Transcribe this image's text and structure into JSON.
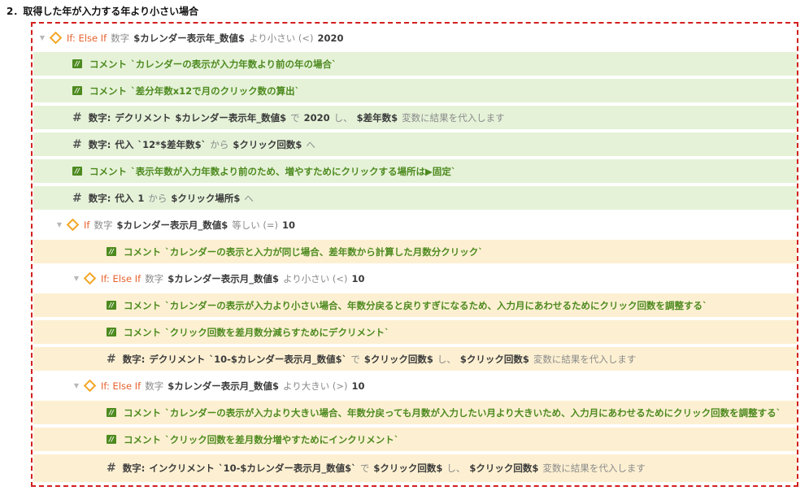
{
  "heading": "2．取得した年が入力する年より小さい場合",
  "rows": [
    {
      "if_kw": "If: Else If",
      "type": "数字",
      "var": "$カレンダー表示年_数値$",
      "cond": "より小さい (<)",
      "val": "2020"
    },
    {
      "label": "コメント",
      "text": "`カレンダーの表示が入力年数より前の年の場合`"
    },
    {
      "label": "コメント",
      "text": "`差分年数x12で月のクリック数の算出`"
    },
    {
      "label": "数字:",
      "action": "デクリメント",
      "var": "$カレンダー表示年_数値$",
      "mid": "で",
      "val": "2020",
      "mid2": "し、",
      "var2": "$差年数$",
      "tail": "変数に結果を代入します"
    },
    {
      "label": "数字:",
      "action": "代入",
      "quote": "`12*$差年数$`",
      "mid": "から",
      "var": "$クリック回数$",
      "tail": "へ"
    },
    {
      "label": "コメント",
      "text": "`表示年数が入力年数より前のため、増やすためにクリックする場所は▶固定`"
    },
    {
      "label": "数字:",
      "action": "代入",
      "val": "1",
      "mid": "から",
      "var": "$クリック場所$",
      "tail": "へ"
    },
    {
      "if_kw": "If",
      "type": "数字",
      "var": "$カレンダー表示月_数値$",
      "cond": "等しい (=)",
      "val": "10"
    },
    {
      "label": "コメント",
      "text": "`カレンダーの表示と入力が同じ場合、差年数から計算した月数分クリック`"
    },
    {
      "if_kw": "If: Else If",
      "type": "数字",
      "var": "$カレンダー表示月_数値$",
      "cond": "より小さい (<)",
      "val": "10"
    },
    {
      "label": "コメント",
      "text": "`カレンダーの表示が入力より小さい場合、年数分戻ると戻りすぎになるため、入力月にあわせるためにクリック回数を調整する`"
    },
    {
      "label": "コメント",
      "text": "`クリック回数を差月数分減らすためにデクリメント`"
    },
    {
      "label": "数字:",
      "action": "デクリメント",
      "quote": "`10-$カレンダー表示月_数値$`",
      "mid": "で",
      "var": "$クリック回数$",
      "mid2": "し、",
      "var2": "$クリック回数$",
      "tail": "変数に結果を代入します"
    },
    {
      "if_kw": "If: Else If",
      "type": "数字",
      "var": "$カレンダー表示月_数値$",
      "cond": "より大きい (>)",
      "val": "10"
    },
    {
      "label": "コメント",
      "text": "`カレンダーの表示が入力より大きい場合、年数分戻っても月数が入力したい月より大きいため、入力月にあわせるためにクリック回数を調整する`"
    },
    {
      "label": "コメント",
      "text": "`クリック回数を差月数分増やすためにインクリメント`"
    },
    {
      "label": "数字:",
      "action": "インクリメント",
      "quote": "`10-$カレンダー表示月_数値$`",
      "mid": "で",
      "var": "$クリック回数$",
      "mid2": "し、",
      "var2": "$クリック回数$",
      "tail": "変数に結果を代入します"
    }
  ],
  "colors": {
    "frame": "#d31f1f",
    "green_row": "#e5f2d8",
    "yellow_row": "#fdf0d2",
    "keyword": "#e8622d",
    "comment": "#4d8a1f",
    "diamond": "#f3a623"
  },
  "icons": {
    "caret": "chevron-down-icon",
    "if": "diamond-icon",
    "comment": "comment-icon",
    "number": "hash-icon"
  }
}
